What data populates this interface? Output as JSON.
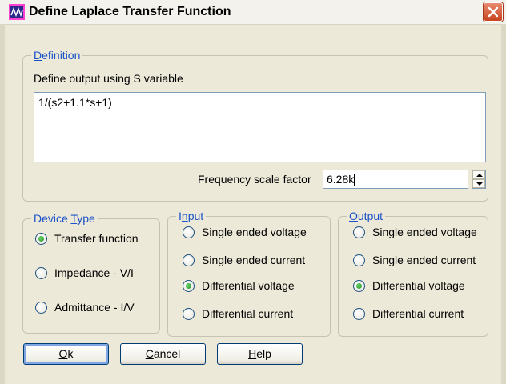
{
  "window": {
    "title": "Define Laplace Transfer Function"
  },
  "definition": {
    "legend": "Definition",
    "mnemonic": "D",
    "legend_rest": "efinition",
    "instruction": "Define output using S variable",
    "expression": "1/(s2+1.1*s+1)",
    "freq_label": "Frequency scale factor",
    "freq_value": "6.28k"
  },
  "device_type": {
    "legend_pre": "Device ",
    "mnemonic": "T",
    "legend_post": "ype",
    "options": [
      "Transfer function",
      "Impedance - V/I",
      "Admittance - I/V"
    ],
    "selected": "Transfer function"
  },
  "input": {
    "legend_pre": "I",
    "mnemonic": "n",
    "legend_post": "put",
    "options": [
      "Single ended voltage",
      "Single ended current",
      "Differential voltage",
      "Differential current"
    ],
    "selected": "Differential voltage"
  },
  "output": {
    "legend_pre": "",
    "mnemonic": "O",
    "legend_post": "utput",
    "options": [
      "Single ended voltage",
      "Single ended current",
      "Differential voltage",
      "Differential current"
    ],
    "selected": "Differential voltage"
  },
  "buttons": {
    "ok": {
      "mnemonic": "O",
      "rest": "k"
    },
    "cancel": {
      "mnemonic": "C",
      "rest": "ancel"
    },
    "help": {
      "mnemonic": "H",
      "rest": "elp"
    }
  }
}
